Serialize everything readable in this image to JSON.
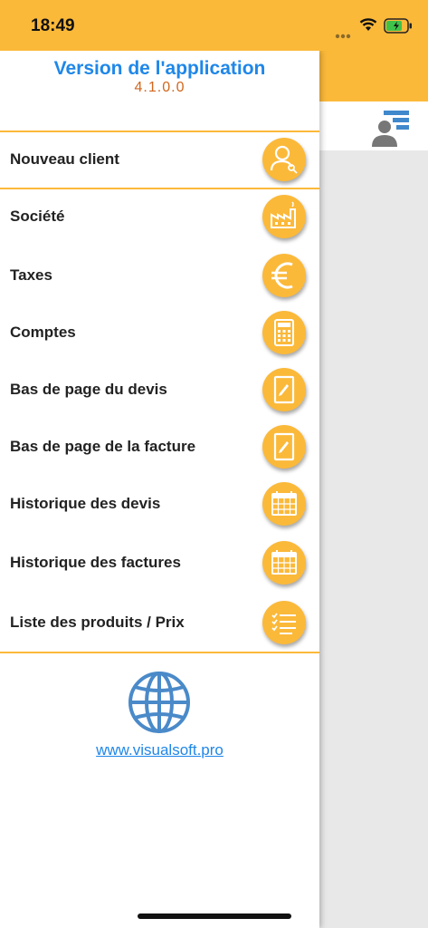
{
  "status_bar": {
    "time": "18:49",
    "background": "#fbb93a"
  },
  "drawer": {
    "version_title": "Version de l'application",
    "version_number": "4.1.0.0",
    "new_client": {
      "label": "Nouveau client",
      "icon": "new-client-icon"
    },
    "items": [
      {
        "label": "Société",
        "icon": "factory-icon"
      },
      {
        "label": "Taxes",
        "icon": "euro-icon"
      },
      {
        "label": "Comptes",
        "icon": "calculator-icon"
      },
      {
        "label": "Bas de page du devis",
        "icon": "note-edit-icon"
      },
      {
        "label": "Bas de page de la facture",
        "icon": "note-edit-icon"
      },
      {
        "label": "Historique des devis",
        "icon": "calendar-icon"
      },
      {
        "label": "Historique des factures",
        "icon": "calendar-icon"
      },
      {
        "label": "Liste des produits / Prix",
        "icon": "checklist-icon"
      }
    ],
    "website": "www.visualsoft.pro"
  },
  "colors": {
    "accent": "#fbb93a",
    "title_blue": "#1f87e8",
    "version_orange": "#d2661c",
    "label_text": "#222222"
  }
}
